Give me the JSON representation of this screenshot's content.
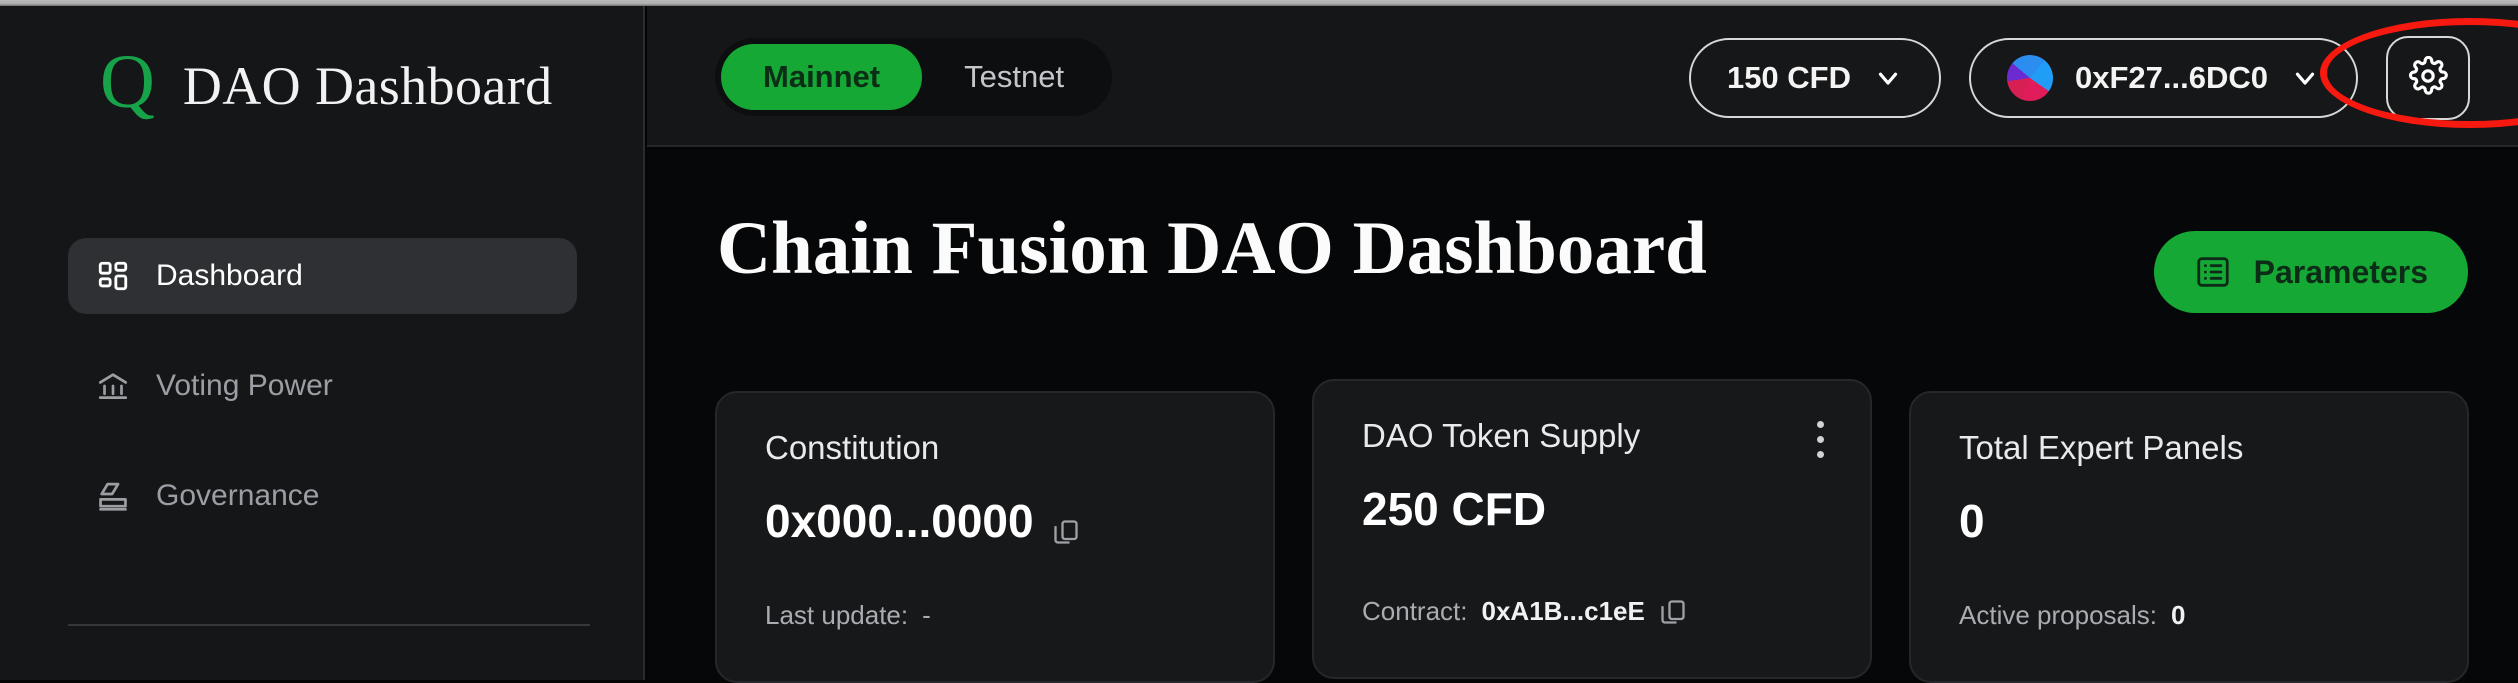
{
  "brand": {
    "logo_glyph": "Q",
    "logo_icon": "q-logo-icon",
    "title": "DAO Dashboard"
  },
  "sidebar": {
    "items": [
      {
        "label": "Dashboard",
        "icon": "grid-icon",
        "active": true
      },
      {
        "label": "Voting Power",
        "icon": "bank-icon",
        "active": false
      },
      {
        "label": "Governance",
        "icon": "ballot-icon",
        "active": false
      }
    ]
  },
  "header": {
    "network_toggle": {
      "options": [
        {
          "label": "Mainnet",
          "active": true
        },
        {
          "label": "Testnet",
          "active": false
        }
      ]
    },
    "balance_button": {
      "label": "150 CFD",
      "chevron_icon": "chevron-down-icon",
      "annotated": true,
      "annotation_color": "#f5190f"
    },
    "wallet_button": {
      "label": "0xF27...6DC0",
      "avatar_icon": "wallet-avatar-icon",
      "chevron_icon": "chevron-down-icon"
    },
    "settings_button": {
      "icon": "gear-icon"
    }
  },
  "main": {
    "page_title": "Chain Fusion DAO Dashboard",
    "parameters_button": {
      "label": "Parameters",
      "icon": "list-icon"
    },
    "cards": [
      {
        "title": "Constitution",
        "value": "0x000...0000",
        "value_copy_icon": "copy-icon",
        "foot_label": "Last update:",
        "foot_value": "-",
        "has_kebab": false
      },
      {
        "title": "DAO Token Supply",
        "value": "250 CFD",
        "foot_label": "Contract:",
        "foot_value": "0xA1B...c1eE",
        "foot_copy_icon": "copy-icon",
        "has_kebab": true,
        "kebab_icon": "kebab-menu-icon"
      },
      {
        "title": "Total Expert Panels",
        "value": "0",
        "foot_label": "Active proposals:",
        "foot_value": "0",
        "has_kebab": false
      }
    ]
  },
  "colors": {
    "accent_green": "#16a834",
    "annotation_red": "#f5190f",
    "sidebar_bg": "#151618",
    "main_bg": "#060708",
    "card_bg": "#17181a"
  }
}
